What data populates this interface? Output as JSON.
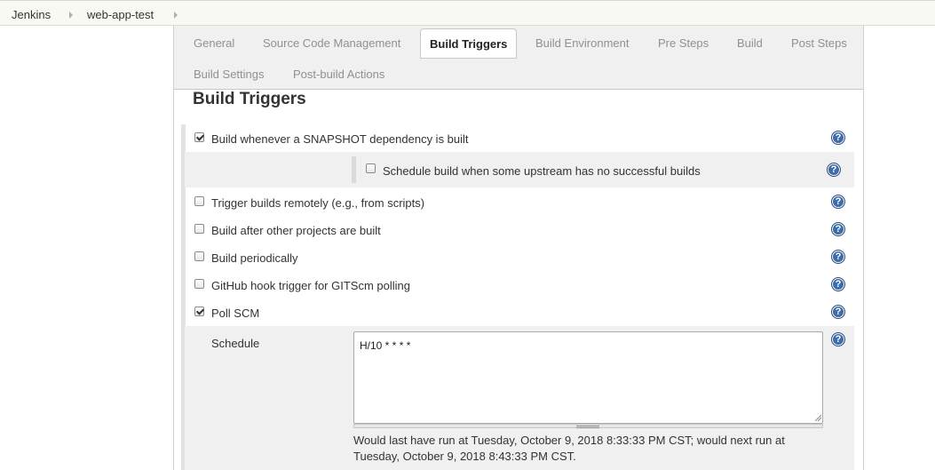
{
  "breadcrumb": {
    "items": [
      {
        "label": "Jenkins"
      },
      {
        "label": "web-app-test"
      }
    ]
  },
  "tabs": {
    "row1": [
      {
        "label": "General"
      },
      {
        "label": "Source Code Management"
      },
      {
        "label": "Build Triggers",
        "active": true
      },
      {
        "label": "Build Environment"
      },
      {
        "label": "Pre Steps"
      },
      {
        "label": "Build"
      },
      {
        "label": "Post Steps"
      }
    ],
    "row2": [
      {
        "label": "Build Settings"
      },
      {
        "label": "Post-build Actions"
      }
    ]
  },
  "section": {
    "title": "Build Triggers"
  },
  "triggers": {
    "snapshot": {
      "label": "Build whenever a SNAPSHOT dependency is built",
      "checked": true
    },
    "upstream_no_success": {
      "label": "Schedule build when some upstream has no successful builds",
      "checked": false
    },
    "remote": {
      "label": "Trigger builds remotely (e.g., from scripts)",
      "checked": false
    },
    "after_other": {
      "label": "Build after other projects are built",
      "checked": false
    },
    "periodically": {
      "label": "Build periodically",
      "checked": false
    },
    "github_hook": {
      "label": "GitHub hook trigger for GITScm polling",
      "checked": false
    },
    "poll_scm": {
      "label": "Poll SCM",
      "checked": true
    }
  },
  "poll": {
    "schedule_label": "Schedule",
    "schedule_value": "H/10 * * * *",
    "info": "Would last have run at Tuesday, October 9, 2018 8:33:33 PM CST; would next run at Tuesday, October 9, 2018 8:43:33 PM CST."
  },
  "icons": {
    "help": "help-icon",
    "checkbox": "checkbox-icon"
  },
  "colors": {
    "help_icon": "#3f6ba8",
    "tabbar_bg": "#f0f0f0",
    "breadcrumb_bg": "#f9f9f4"
  }
}
